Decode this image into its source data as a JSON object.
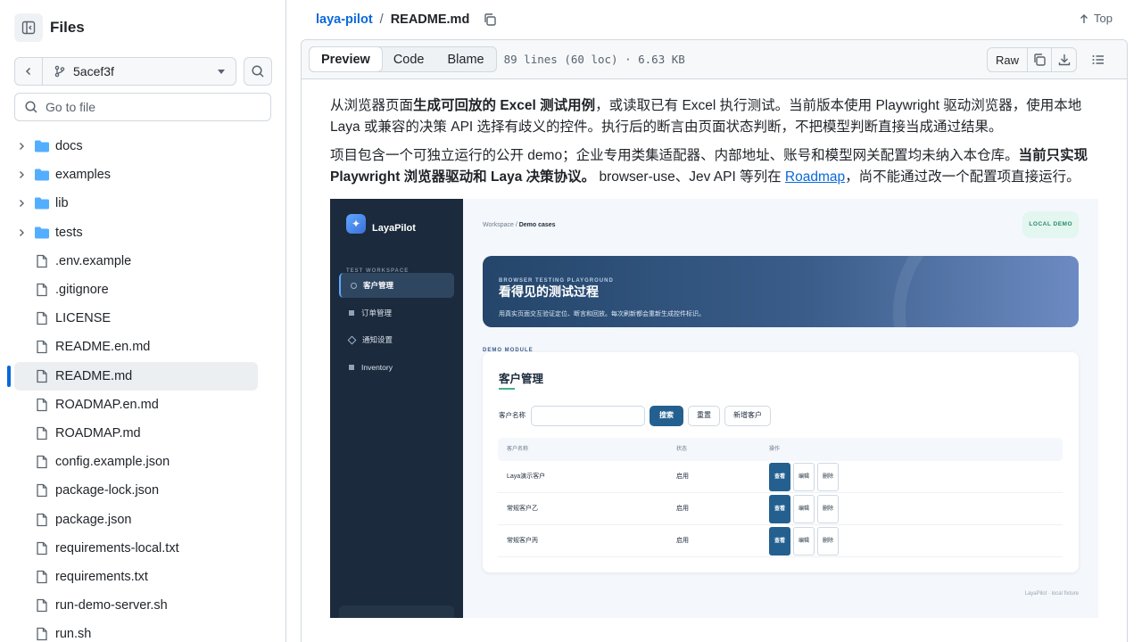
{
  "sidebar": {
    "title": "Files",
    "branch": "5acef3f",
    "goto_placeholder": "Go to file",
    "tree": [
      {
        "type": "folder",
        "label": "docs"
      },
      {
        "type": "folder",
        "label": "examples"
      },
      {
        "type": "folder",
        "label": "lib"
      },
      {
        "type": "folder",
        "label": "tests"
      },
      {
        "type": "file",
        "label": ".env.example"
      },
      {
        "type": "file",
        "label": ".gitignore"
      },
      {
        "type": "file",
        "label": "LICENSE"
      },
      {
        "type": "file",
        "label": "README.en.md"
      },
      {
        "type": "file",
        "label": "README.md",
        "active": true
      },
      {
        "type": "file",
        "label": "ROADMAP.en.md"
      },
      {
        "type": "file",
        "label": "ROADMAP.md"
      },
      {
        "type": "file",
        "label": "config.example.json"
      },
      {
        "type": "file",
        "label": "package-lock.json"
      },
      {
        "type": "file",
        "label": "package.json"
      },
      {
        "type": "file",
        "label": "requirements-local.txt"
      },
      {
        "type": "file",
        "label": "requirements.txt"
      },
      {
        "type": "file",
        "label": "run-demo-server.sh"
      },
      {
        "type": "file",
        "label": "run.sh"
      }
    ]
  },
  "breadcrumb": {
    "repo": "laya-pilot",
    "separator": "/",
    "file": "README.md",
    "top_label": "Top"
  },
  "file_header": {
    "tabs": [
      "Preview",
      "Code",
      "Blame"
    ],
    "active_tab": "Preview",
    "meta": "89 lines (60 loc) · 6.63 KB",
    "raw_label": "Raw"
  },
  "readme": {
    "p1_a": "从浏览器页面",
    "p1_b": "生成可回放的 Excel 测试用例",
    "p1_c": "，或读取已有 Excel 执行测试。当前版本使用 Playwright 驱动浏览器，使用本地 Laya 或兼容的决策 API 选择有歧义的控件。执行后的断言由页面状态判断，不把模型判断直接当成通过结果。",
    "p2_a": "项目包含一个可独立运行的公开 demo；企业专用类集适配器、内部地址、账号和模型网关配置均未纳入本仓库。",
    "p2_b": "当前只实现 Playwright 浏览器驱动和 Laya 决策协议。",
    "p2_c": " browser-use、Jev API 等列在 ",
    "p2_link": "Roadmap",
    "p2_d": "，尚不能通过改一个配置项直接运行。"
  },
  "demo": {
    "brand": "LayaPilot",
    "workspace_label": "TEST WORKSPACE",
    "nav": [
      "客户管理",
      "订单管理",
      "通知设置",
      "Inventory"
    ],
    "crumb_a": "Workspace / ",
    "crumb_b": "Demo cases",
    "badge": "LOCAL DEMO",
    "hero_kicker": "BROWSER TESTING PLAYGROUND",
    "hero_title": "看得见的测试过程",
    "hero_sub": "用真实页面交互验证定位、断言和回放。每次刷新都会重新生成控件标识。",
    "module_label": "DEMO MODULE",
    "card_title": "客户管理",
    "field_label": "客户名称",
    "btn_search": "搜索",
    "btn_reset": "重置",
    "btn_add": "新增客户",
    "columns": [
      "客户名称",
      "状态",
      "操作"
    ],
    "rows": [
      {
        "name": "Laya演示客户",
        "status": "启用"
      },
      {
        "name": "常规客户乙",
        "status": "启用"
      },
      {
        "name": "常规客户丙",
        "status": "启用"
      }
    ],
    "actions": [
      "查看",
      "编辑",
      "删除"
    ],
    "footer": "LayaPilot · local fixture"
  },
  "colors": {
    "link": "#0969da",
    "active_bar": "#0969da",
    "folder": "#54aeff"
  }
}
